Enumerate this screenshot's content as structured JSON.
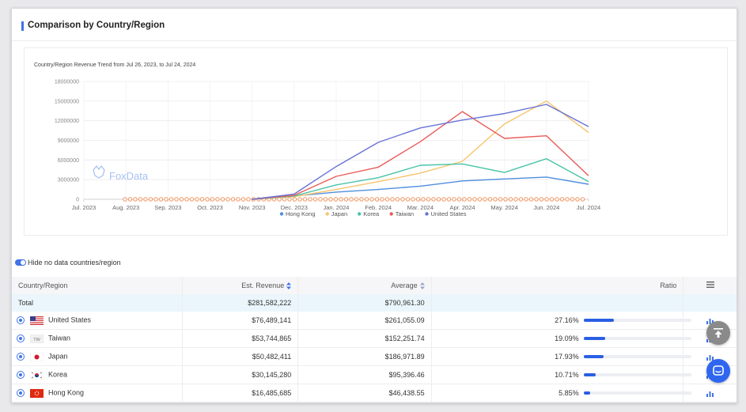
{
  "section": {
    "title": "Comparison by Country/Region"
  },
  "colors": {
    "accent": "#3f73e6",
    "hong_kong": "#4f8fe0",
    "japan": "#f7c46c",
    "korea": "#49c4a8",
    "taiwan": "#ea5b58",
    "united_states": "#6873d6",
    "dots": "#f19257",
    "ratio_fill": "#2a5fe3"
  },
  "chart_data": {
    "type": "line",
    "title": "Country/Region Revenue Trend from Jul 26, 2023, to Jul 24, 2024",
    "x": [
      "Jul. 2023",
      "Aug. 2023",
      "Sep. 2023",
      "Oct. 2023",
      "Nov. 2023",
      "Dec. 2023",
      "Jan. 2024",
      "Feb. 2024",
      "Mar. 2024",
      "Apr. 2024",
      "May. 2024",
      "Jun. 2024",
      "Jul. 2024"
    ],
    "ylim": [
      0,
      18000000
    ],
    "yticks": [
      "0",
      "3000000",
      "6000000",
      "9000000",
      "12000000",
      "15000000",
      "18000000"
    ],
    "grid": true,
    "legend_position": "bottom",
    "watermark": "FoxData",
    "series": [
      {
        "name": "Hong Kong",
        "color": "#4f8fe0",
        "values": [
          null,
          null,
          null,
          null,
          0,
          500000,
          1100000,
          1500000,
          2000000,
          2800000,
          3100000,
          3400000,
          2300000
        ]
      },
      {
        "name": "Japan",
        "color": "#f7c46c",
        "values": [
          null,
          null,
          null,
          null,
          0,
          400000,
          1500000,
          2700000,
          4000000,
          5800000,
          11500000,
          15000000,
          10200000
        ]
      },
      {
        "name": "Korea",
        "color": "#49c4a8",
        "values": [
          null,
          null,
          null,
          null,
          0,
          500000,
          2200000,
          3300000,
          5200000,
          5400000,
          4100000,
          6200000,
          2700000
        ]
      },
      {
        "name": "Taiwan",
        "color": "#ea5b58",
        "values": [
          null,
          null,
          null,
          null,
          0,
          600000,
          3500000,
          4900000,
          8800000,
          13400000,
          9300000,
          9700000,
          3600000
        ]
      },
      {
        "name": "United States",
        "color": "#6873d6",
        "values": [
          null,
          null,
          null,
          null,
          0,
          800000,
          5000000,
          8700000,
          10900000,
          12100000,
          13100000,
          14500000,
          11100000
        ]
      }
    ]
  },
  "toggle": {
    "label": "Hide no data countries/region",
    "on": true
  },
  "table": {
    "headers": {
      "country": "Country/Region",
      "revenue": "Est. Revenue",
      "average": "Average",
      "ratio": "Ratio",
      "menu_icon": "menu-icon"
    },
    "total": {
      "label": "Total",
      "revenue": "$281,582,222",
      "average": "$790,961.30"
    },
    "rows": [
      {
        "country": "United States",
        "flag": "flag-us",
        "revenue": "$76,489,141",
        "average": "$261,055.09",
        "ratio": "27.16%",
        "ratio_value": 0.2716
      },
      {
        "country": "Taiwan",
        "flag": "flag-tw",
        "flag_text": "TW",
        "revenue": "$53,744,865",
        "average": "$152,251.74",
        "ratio": "19.09%",
        "ratio_value": 0.1909
      },
      {
        "country": "Japan",
        "flag": "flag-jp",
        "revenue": "$50,482,411",
        "average": "$186,971.89",
        "ratio": "17.93%",
        "ratio_value": 0.1793
      },
      {
        "country": "Korea",
        "flag": "flag-kr",
        "revenue": "$30,145,280",
        "average": "$95,396.46",
        "ratio": "10.71%",
        "ratio_value": 0.1071
      },
      {
        "country": "Hong Kong",
        "flag": "flag-hk",
        "revenue": "$16,485,685",
        "average": "$46,438.55",
        "ratio": "5.85%",
        "ratio_value": 0.0585
      }
    ]
  },
  "fabs": {
    "scroll_top_icon": "arrow-up-icon",
    "chat_icon": "chat-icon"
  }
}
